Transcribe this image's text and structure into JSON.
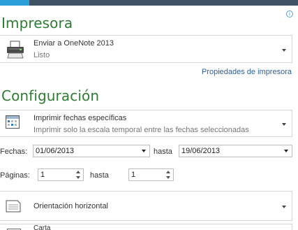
{
  "printer_section": {
    "title": "Impresora",
    "printer_name": "Enviar a OneNote 2013",
    "printer_status": "Listo",
    "properties_link": "Propiedades de impresora"
  },
  "settings_section": {
    "title": "Configuración",
    "print_range": {
      "primary": "Imprimir fechas específicas",
      "secondary": "Imprimir solo la escala temporal entre las fechas seleccionadas"
    },
    "dates": {
      "label": "Fechas:",
      "from": "01/06/2013",
      "to_label": "hasta",
      "to": "19/06/2013"
    },
    "pages": {
      "label": "Páginas:",
      "from": "1",
      "to_label": "hasta",
      "to": "1"
    },
    "orientation": "Orientación horizontal",
    "paper_size": "Carta"
  },
  "icons": {
    "info": "info-icon",
    "printer": "printer-icon",
    "calendar": "calendar-icon",
    "orientation": "document-icon",
    "paper": "paper-icon"
  },
  "colors": {
    "accent_tab": "#2b9fd8",
    "header_dark": "#3e5366",
    "section_title": "#2e7d32",
    "link": "#2a5fa3"
  }
}
